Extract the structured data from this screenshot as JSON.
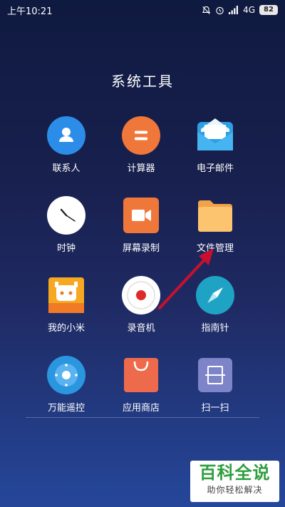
{
  "status_bar": {
    "time": "上午10:21",
    "network": "4G",
    "battery": "82",
    "icons": [
      "mute-icon",
      "alarm-icon",
      "signal-icon",
      "battery-icon"
    ]
  },
  "folder": {
    "title": "系统工具"
  },
  "apps": [
    {
      "label": "联系人",
      "icon": "contacts-icon"
    },
    {
      "label": "计算器",
      "icon": "calculator-icon"
    },
    {
      "label": "电子邮件",
      "icon": "email-icon"
    },
    {
      "label": "时钟",
      "icon": "clock-icon"
    },
    {
      "label": "屏幕录制",
      "icon": "screen-recorder-icon"
    },
    {
      "label": "文件管理",
      "icon": "file-manager-icon"
    },
    {
      "label": "我的小米",
      "icon": "mi-icon"
    },
    {
      "label": "录音机",
      "icon": "recorder-icon"
    },
    {
      "label": "指南针",
      "icon": "compass-icon"
    },
    {
      "label": "万能遥控",
      "icon": "remote-icon"
    },
    {
      "label": "应用商店",
      "icon": "app-store-icon"
    },
    {
      "label": "扫一扫",
      "icon": "scanner-icon"
    }
  ],
  "watermark": {
    "title": "百科全说",
    "subtitle": "助你轻松解决"
  },
  "colors": {
    "accent_blue": "#2b8de8",
    "accent_orange": "#f0773a",
    "arrow_red": "#c8102e",
    "watermark_green": "#2e9e3e"
  }
}
